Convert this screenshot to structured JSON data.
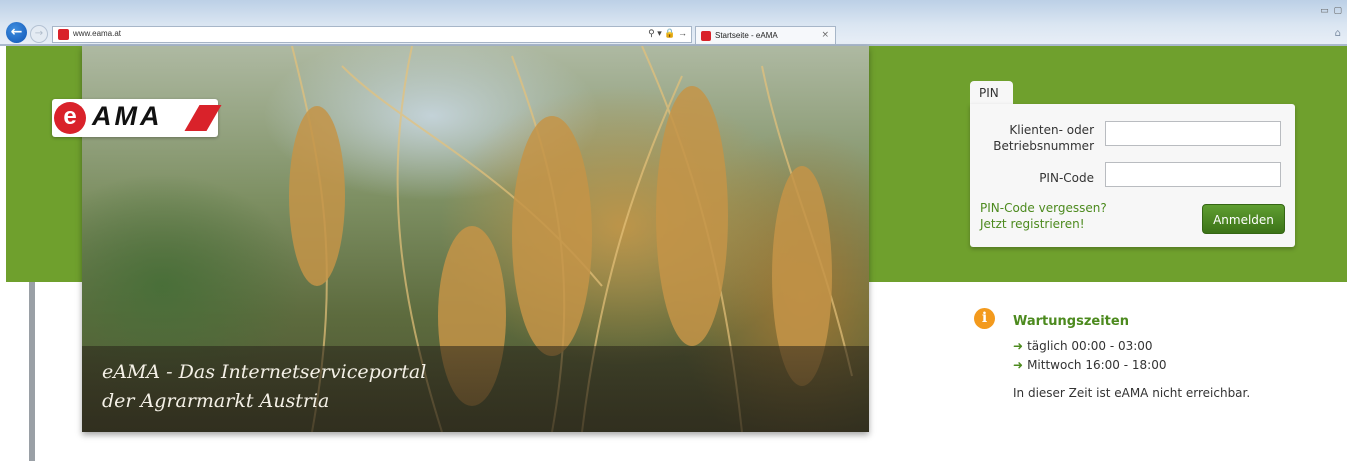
{
  "browser": {
    "url": "www.eama.at",
    "address_tools": "⚲ ▾ 🔒 →",
    "tab_title": "Startseite - eAMA",
    "tab_close": "×"
  },
  "hero": {
    "title_line1": "eAMA - Das Internetserviceportal",
    "title_line2": "der Agrarmarkt Austria"
  },
  "logo": {
    "e": "e",
    "text": "AMA"
  },
  "login": {
    "tab_label": "PIN",
    "client_label_line1": "Klienten- oder",
    "client_label_line2": "Betriebsnummer",
    "client_value": "",
    "pin_label": "PIN-Code",
    "pin_value": "",
    "forgot_link": "PIN-Code vergessen?",
    "register_link": "Jetzt registrieren!",
    "submit_label": "Anmelden"
  },
  "maintenance": {
    "title": "Wartungszeiten",
    "daily": "täglich 00:00 - 03:00",
    "wednesday": "Mittwoch 16:00 - 18:00",
    "note": "In dieser Zeit ist eAMA nicht erreichbar."
  },
  "colors": {
    "brand_green": "#6fa02d",
    "link_green": "#4c8a1e",
    "logo_red": "#d9222a",
    "info_orange": "#f39a1d"
  },
  "icons": [
    "back-arrow-icon",
    "forward-arrow-icon",
    "favicon-icon",
    "search-icon",
    "lock-icon",
    "close-icon",
    "home-icon",
    "info-icon",
    "arrow-right-icon"
  ]
}
